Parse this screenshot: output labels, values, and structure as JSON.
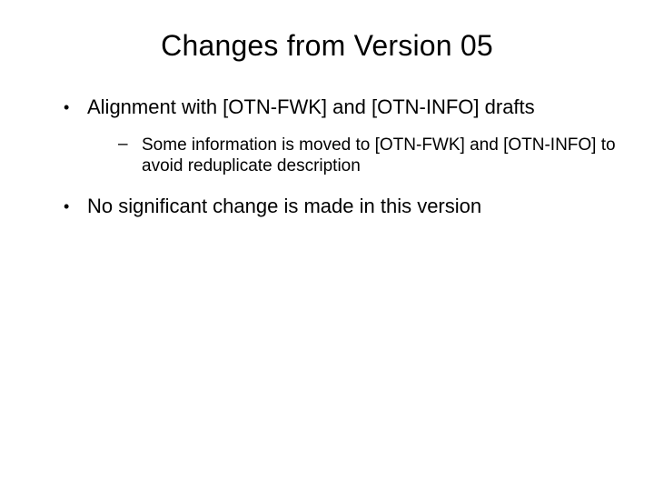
{
  "title": "Changes from Version 05",
  "bullets": [
    {
      "text": "Alignment with [OTN-FWK] and [OTN-INFO] drafts",
      "sub": [
        {
          "text": "Some information is moved to [OTN-FWK] and [OTN-INFO] to avoid reduplicate description"
        }
      ]
    },
    {
      "text": "No significant change is made in this version",
      "sub": []
    }
  ]
}
